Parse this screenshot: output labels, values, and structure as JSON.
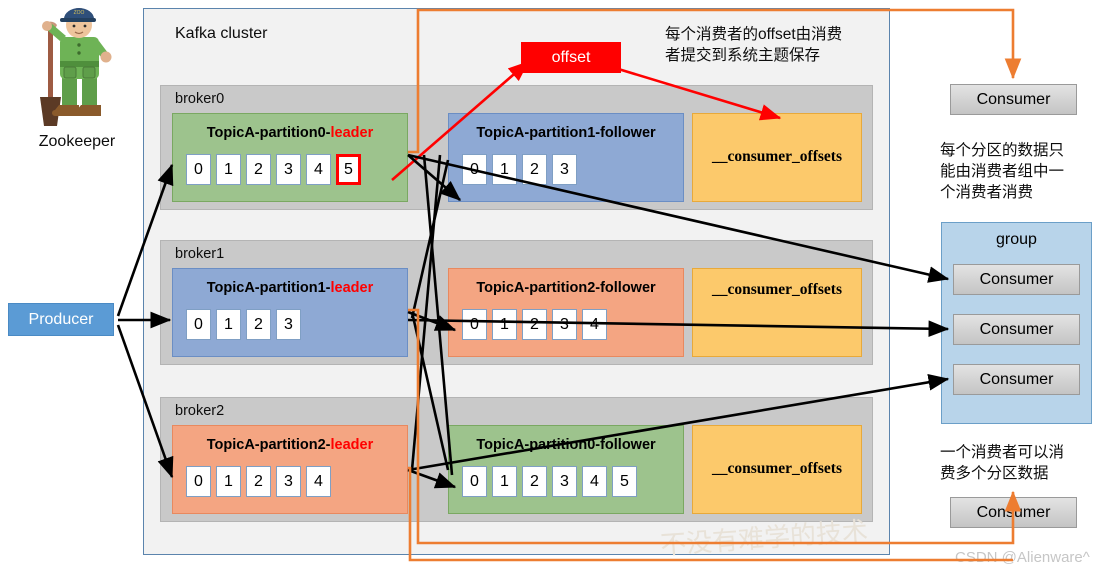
{
  "cluster": {
    "label": "Kafka cluster"
  },
  "zookeeper": {
    "label": "Zookeeper",
    "icon": "zookeeper-mascot-icon"
  },
  "producer": {
    "label": "Producer"
  },
  "offset_badge": {
    "label": "offset"
  },
  "brokers": [
    {
      "label": "broker0",
      "leader": {
        "title_main": "TopicA-partition0-",
        "title_role": "leader",
        "cells": [
          "0",
          "1",
          "2",
          "3",
          "4",
          "5"
        ],
        "highlight_index": 5,
        "color": "green"
      },
      "follower": {
        "title": "TopicA-partition1-follower",
        "cells": [
          "0",
          "1",
          "2",
          "3"
        ],
        "color": "blue"
      },
      "offsets": {
        "label": "__consumer_offsets"
      }
    },
    {
      "label": "broker1",
      "leader": {
        "title_main": "TopicA-partition1-",
        "title_role": "leader",
        "cells": [
          "0",
          "1",
          "2",
          "3"
        ],
        "highlight_index": -1,
        "color": "blue"
      },
      "follower": {
        "title": "TopicA-partition2-follower",
        "cells": [
          "0",
          "1",
          "2",
          "3",
          "4"
        ],
        "color": "salmon"
      },
      "offsets": {
        "label": "__consumer_offsets"
      }
    },
    {
      "label": "broker2",
      "leader": {
        "title_main": "TopicA-partition2-",
        "title_role": "leader",
        "cells": [
          "0",
          "1",
          "2",
          "3",
          "4"
        ],
        "highlight_index": -1,
        "color": "salmon"
      },
      "follower": {
        "title": "TopicA-partition0-follower",
        "cells": [
          "0",
          "1",
          "2",
          "3",
          "4",
          "5"
        ],
        "color": "green"
      },
      "offsets": {
        "label": "__consumer_offsets"
      }
    }
  ],
  "notes": {
    "offset_commit": "每个消费者的offset由消费\n者提交到系统主题保存",
    "one_partition_one_consumer": "每个分区的数据只\n能由消费者组中一\n个消费者消费",
    "one_consumer_many_partitions": "一个消费者可以消\n费多个分区数据"
  },
  "consumers": {
    "top": {
      "label": "Consumer"
    },
    "group": {
      "label": "group",
      "members": [
        {
          "label": "Consumer"
        },
        {
          "label": "Consumer"
        },
        {
          "label": "Consumer"
        }
      ]
    },
    "bottom": {
      "label": "Consumer"
    }
  },
  "watermark": {
    "text": "不没有难学的技术",
    "credit": "CSDN @Alienware^"
  },
  "colors": {
    "cluster_border": "#5b84ad",
    "broker_bg": "#c9c9c9",
    "leader_red": "#ff0000",
    "offset_badge": "#ff0000",
    "offsets_box": "#fcc96b",
    "producer_blue": "#5b9bd5",
    "group_blue": "#b8d4ea",
    "orange_flow": "#ed7d31",
    "green_partition": "#9dc38d",
    "blue_partition": "#8ea9d4",
    "salmon_partition": "#f4a582"
  }
}
